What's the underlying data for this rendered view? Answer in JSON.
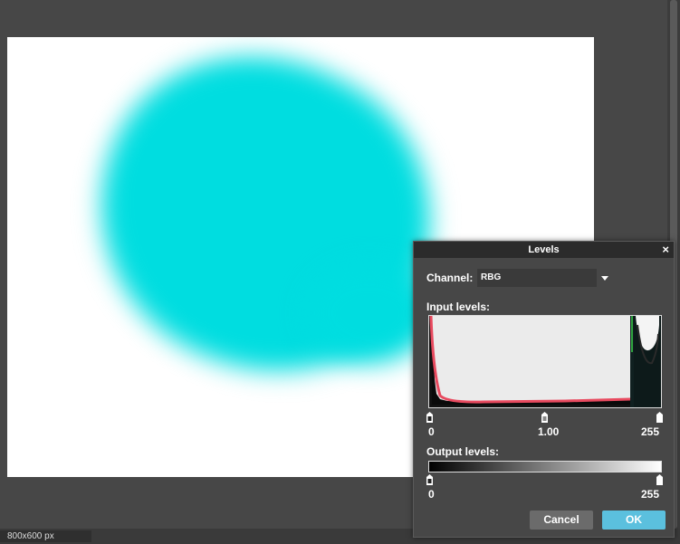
{
  "status": {
    "image_size": "800x600 px"
  },
  "dialog": {
    "title": "Levels",
    "close_glyph": "×",
    "channel_label": "Channel:",
    "channel_value": "RBG",
    "input_label": "Input levels:",
    "input_black": "0",
    "input_gamma": "1.00",
    "input_white": "255",
    "output_label": "Output levels:",
    "output_black": "0",
    "output_white": "255",
    "cancel_label": "Cancel",
    "ok_label": "OK"
  },
  "colors": {
    "accent_ok": "#5bc0de",
    "image_fill": "#00dde0",
    "histogram_red": "#e84a5f",
    "histogram_green": "#3ad04a"
  },
  "icons": [
    "close-icon",
    "chevron-down-icon",
    "slider-handle-icon"
  ]
}
